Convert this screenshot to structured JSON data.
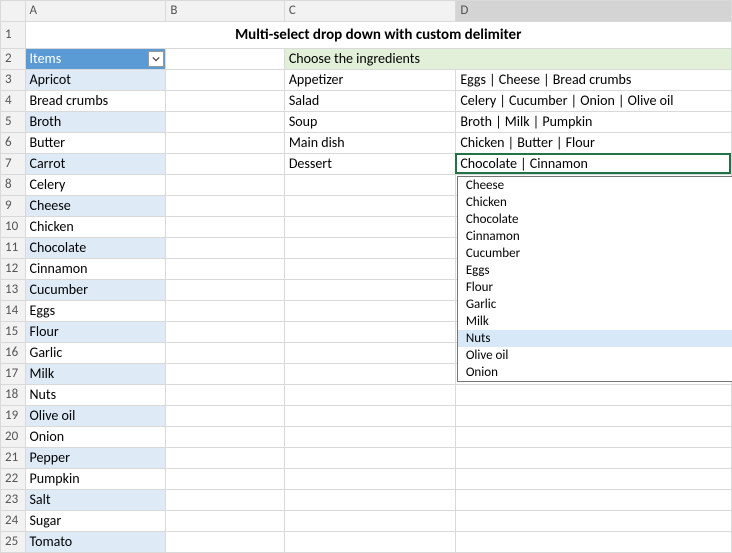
{
  "title": "Multi-select drop down with custom delimiter",
  "columns": [
    "A",
    "B",
    "C",
    "D"
  ],
  "row_numbers": [
    1,
    2,
    3,
    4,
    5,
    6,
    7,
    8,
    9,
    10,
    11,
    12,
    13,
    14,
    15,
    16,
    17,
    18,
    19,
    20,
    21,
    22,
    23,
    24,
    25
  ],
  "items_header": "Items",
  "items": [
    "Apricot",
    "Bread crumbs",
    "Broth",
    "Butter",
    "Carrot",
    "Celery",
    "Cheese",
    "Chicken",
    "Chocolate",
    "Cinnamon",
    "Cucumber",
    "Eggs",
    "Flour",
    "Garlic",
    "Milk",
    "Nuts",
    "Olive oil",
    "Onion",
    "Pepper",
    "Pumpkin",
    "Salt",
    "Sugar",
    "Tomato"
  ],
  "ingredients_header": "Choose the ingredients",
  "dishes": [
    {
      "name": "Appetizer",
      "ingredients": "Eggs | Cheese | Bread crumbs"
    },
    {
      "name": "Salad",
      "ingredients": "Celery | Cucumber | Onion | Olive oil"
    },
    {
      "name": "Soup",
      "ingredients": "Broth | Milk | Pumpkin"
    },
    {
      "name": "Main dish",
      "ingredients": "Chicken | Butter | Flour"
    },
    {
      "name": "Dessert",
      "ingredients": "Chocolate | Cinnamon"
    }
  ],
  "dropdown_options": [
    "Cheese",
    "Chicken",
    "Chocolate",
    "Cinnamon",
    "Cucumber",
    "Eggs",
    "Flour",
    "Garlic",
    "Milk",
    "Nuts",
    "Olive oil",
    "Onion"
  ],
  "dropdown_highlight_index": 9
}
